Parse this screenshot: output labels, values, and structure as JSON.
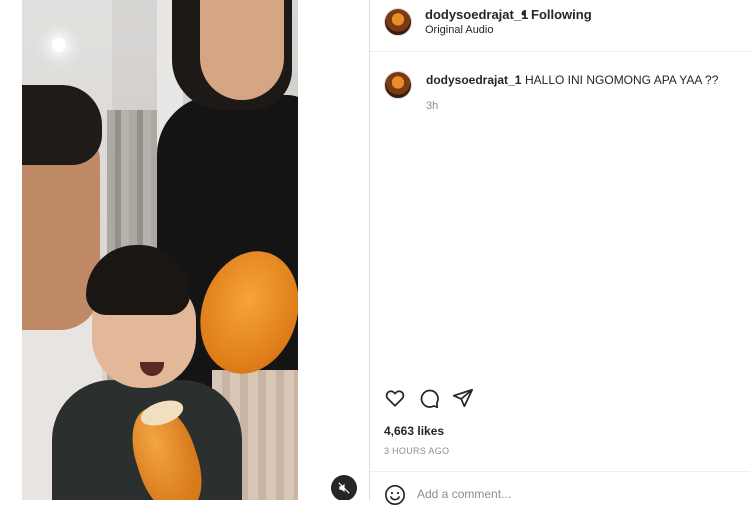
{
  "header": {
    "username": "dodysoedrajat_1",
    "separator": "•",
    "follow_status": "Following",
    "audio": "Original Audio"
  },
  "comments": [
    {
      "username": "dodysoedrajat_1",
      "text": "HALLO INI NGOMONG APA YAA ??",
      "time": "3h"
    }
  ],
  "actions": {
    "icons": [
      "heart-icon",
      "comment-icon",
      "share-icon"
    ]
  },
  "likes": "4,663 likes",
  "posted_ago": "3 HOURS AGO",
  "add_comment": {
    "placeholder": "Add a comment..."
  },
  "media": {
    "mute_icon": "speaker-muted-icon"
  },
  "colors": {
    "text": "#262626",
    "secondary": "#8e8e8e",
    "divider": "#dbdbdb"
  }
}
